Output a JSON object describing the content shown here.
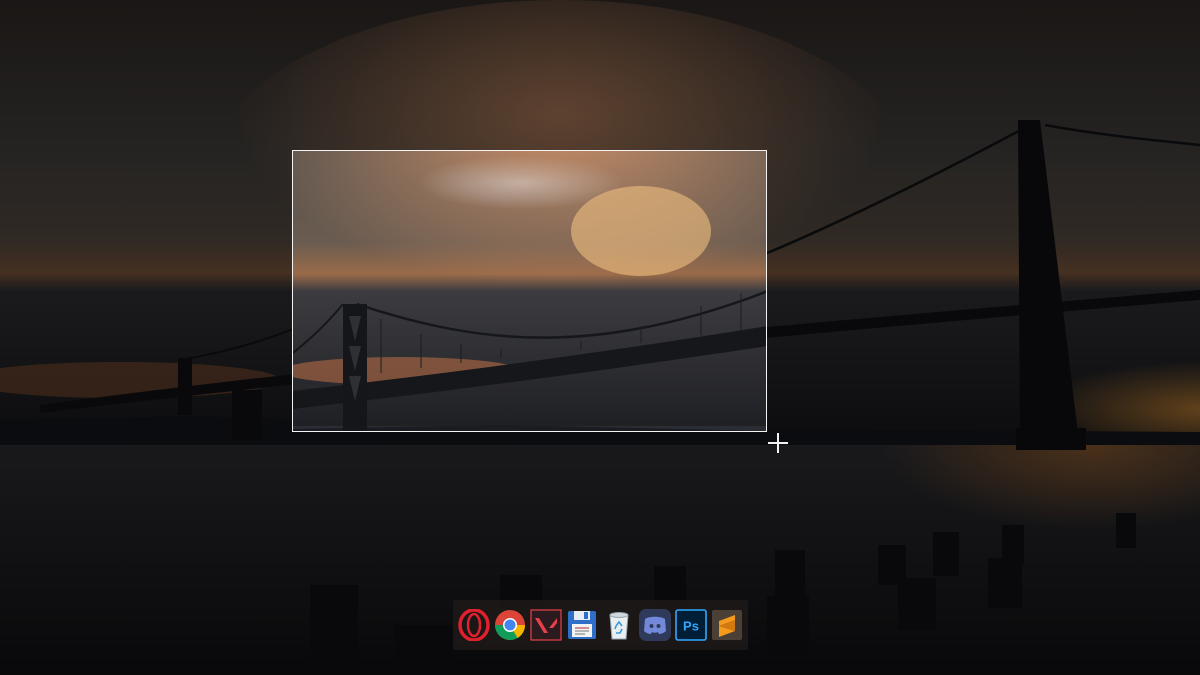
{
  "screen": {
    "mode": "screenshot-region-selection",
    "selection_border_color": "#f4f4f4",
    "dim_overlay_color": "rgba(0,0,0,0.55)"
  },
  "cursor": {
    "icon": "crosshair-icon"
  },
  "dock": {
    "apps": [
      {
        "icon": "opera-icon"
      },
      {
        "icon": "chrome-icon"
      },
      {
        "icon": "valorant-icon"
      },
      {
        "icon": "save-disk-icon"
      },
      {
        "icon": "recycle-bin-icon"
      },
      {
        "icon": "discord-icon"
      },
      {
        "icon": "photoshop-icon",
        "label": "Ps"
      },
      {
        "icon": "sublime-text-icon"
      }
    ]
  },
  "colors": {
    "sky_dark": "#1c1e22",
    "sky_warm": "#e8a06a",
    "water": "#1a1b1f",
    "bridge": "#16181c",
    "opera_red": "#e0202c",
    "valorant_red": "#e8404a",
    "photoshop_blue": "#31a8ff",
    "photoshop_bg": "#001e36",
    "discord_blurple": "#7289da",
    "sublime_orange": "#f49b1e"
  }
}
